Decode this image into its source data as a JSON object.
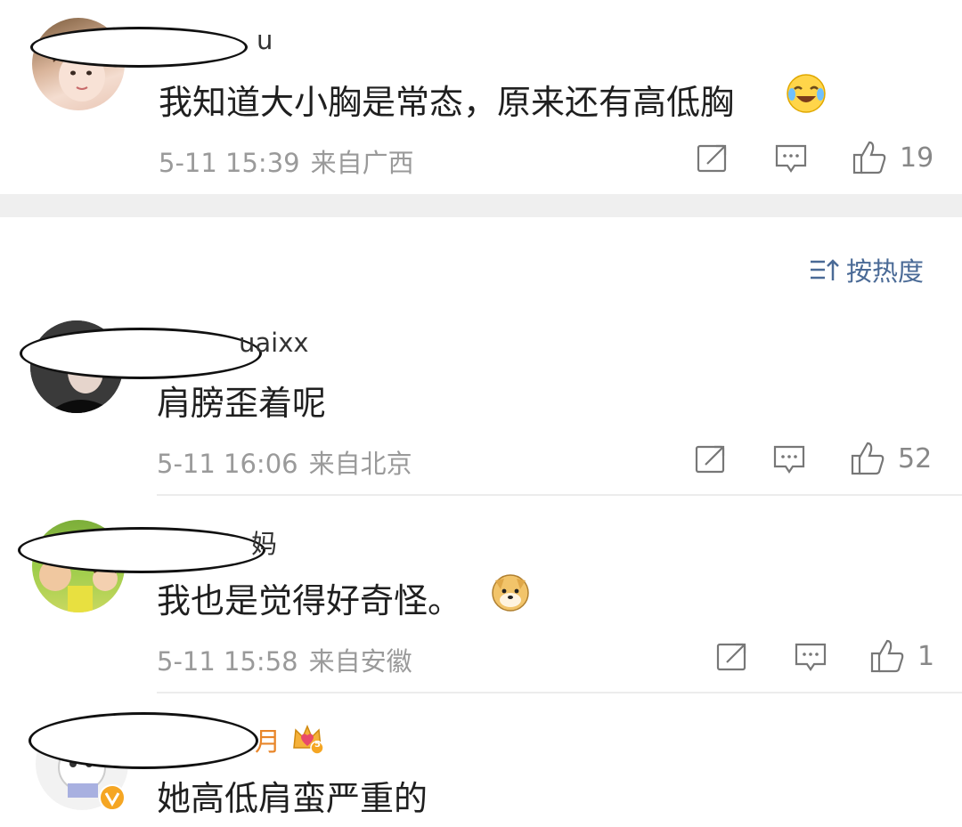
{
  "comments": [
    {
      "name_visible": "u",
      "text": "我知道大小胸是常态，原来还有高低胸",
      "date": "5-11 15:39",
      "location": "来自广西",
      "likes": "19",
      "emoji": "laugh-cry-emoji"
    },
    {
      "name_visible": "uaixx",
      "text": "肩膀歪着呢",
      "date": "5-11 16:06",
      "location": "来自北京",
      "likes": "52"
    },
    {
      "name_visible": "妈",
      "text": "我也是觉得好奇怪。",
      "date": "5-11 15:58",
      "location": "来自安徽",
      "likes": "1",
      "emoji": "doge-emoji"
    },
    {
      "name_visible": "月",
      "text": "她高低肩蛮严重的",
      "badge": "5",
      "verified": true
    }
  ],
  "sort": {
    "label": "按热度"
  },
  "colors": {
    "sort_blue": "#4a6a96",
    "meta_gray": "#9a9a9a",
    "name_orange": "#e8862a"
  }
}
